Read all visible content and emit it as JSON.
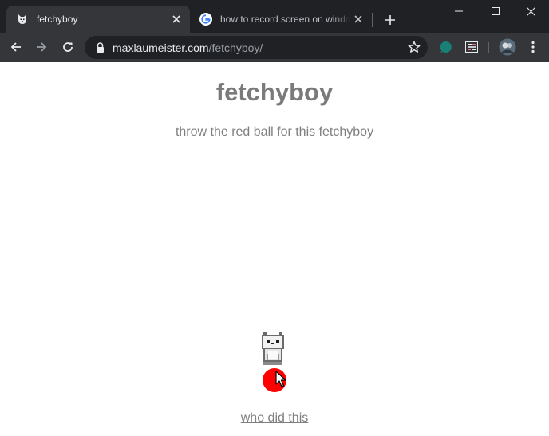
{
  "browser": {
    "tabs": [
      {
        "title": "fetchyboy",
        "active": true
      },
      {
        "title": "how to record screen on windo",
        "active": false
      }
    ],
    "url": {
      "host": "maxlaumeister.com",
      "path": "/fetchyboy/"
    }
  },
  "page": {
    "title": "fetchyboy",
    "subtitle": "throw the red ball for this fetchyboy",
    "credit_link": "who did this"
  },
  "colors": {
    "chrome_dark": "#202124",
    "chrome_tab": "#35363a",
    "heading_gray": "#7a7a7a",
    "ball_red": "#ff0000",
    "extension_teal": "#1a7f74"
  },
  "icons": {
    "tab1_favicon": "dog-favicon-icon",
    "tab2_favicon": "google-g-icon",
    "lock": "lock-icon",
    "bookmark": "star-icon"
  }
}
